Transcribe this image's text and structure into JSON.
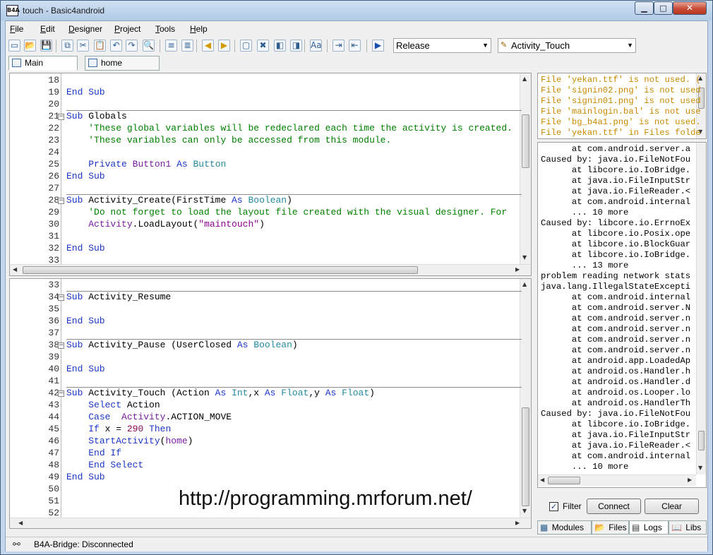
{
  "window": {
    "app_icon": "B4A",
    "title": "touch - Basic4android"
  },
  "window_buttons": {
    "minimize": "▁",
    "maximize": "□",
    "close": "✕"
  },
  "menu": [
    {
      "label": "File",
      "key": "F",
      "rest": "ile"
    },
    {
      "label": "Edit",
      "key": "E",
      "rest": "dit"
    },
    {
      "label": "Designer",
      "key": "D",
      "rest": "esigner"
    },
    {
      "label": "Project",
      "key": "P",
      "rest": "roject"
    },
    {
      "label": "Tools",
      "key": "T",
      "rest": "ools"
    },
    {
      "label": "Help",
      "key": "H",
      "rest": "elp"
    }
  ],
  "toolbar": {
    "icons": [
      "new-file-icon",
      "open-folder-icon",
      "save-icon",
      "copy-icon",
      "cut-icon",
      "paste-icon",
      "undo-icon",
      "redo-icon",
      "find-icon",
      "indent-icon",
      "outdent-icon",
      "back-arrow-icon",
      "forward-arrow-icon",
      "comment-icon",
      "uncomment-icon",
      "bookmark-prev-icon",
      "bookmark-next-icon",
      "font-size-icon",
      "block-indent-icon",
      "block-outdent-icon",
      "run-icon"
    ],
    "glyphs": [
      "▭",
      "📂",
      "💾",
      "⧉",
      "✂",
      "📋",
      "↶",
      "↷",
      "🔍",
      "≡",
      "≣",
      "◀",
      "▶",
      "▢",
      "✖",
      "◧",
      "◨",
      "Aa",
      "⇥",
      "⇤",
      "▶"
    ],
    "build_mode": "Release",
    "module_selector": "Activity_Touch"
  },
  "tabs": [
    {
      "label": "Main",
      "active": true
    },
    {
      "label": "home",
      "active": false
    }
  ],
  "editor_top": {
    "lines": [
      {
        "n": "18",
        "html": ""
      },
      {
        "n": "19",
        "html": "<span class='k'>End Sub</span>"
      },
      {
        "n": "20",
        "html": ""
      },
      {
        "n": "21",
        "html": "<span class='k'>Sub</span> Globals",
        "fold": true
      },
      {
        "n": "22",
        "html": "    <span class='c'>'These global variables will be redeclared each time the activity is created.</span>"
      },
      {
        "n": "23",
        "html": "    <span class='c'>'These variables can only be accessed from this module.</span>"
      },
      {
        "n": "24",
        "html": ""
      },
      {
        "n": "25",
        "html": "    <span class='k'>Private</span> <span class='a'>Button1</span> <span class='k'>As</span> <span class='t'>Button</span>"
      },
      {
        "n": "26",
        "html": "<span class='k'>End Sub</span>"
      },
      {
        "n": "27",
        "html": ""
      },
      {
        "n": "28",
        "html": "<span class='k'>Sub</span> Activity_Create(FirstTime <span class='k'>As</span> <span class='t'>Boolean</span>)",
        "fold": true
      },
      {
        "n": "29",
        "html": "    <span class='c'>'Do not forget to load the layout file created with the visual designer. For</span>"
      },
      {
        "n": "30",
        "html": "    <span class='a'>Activity</span>.LoadLayout(<span class='s'>\"maintouch\"</span>)"
      },
      {
        "n": "31",
        "html": ""
      },
      {
        "n": "32",
        "html": "<span class='k'>End Sub</span>"
      },
      {
        "n": "33",
        "html": ""
      }
    ]
  },
  "editor_bottom": {
    "lines": [
      {
        "n": "33",
        "html": ""
      },
      {
        "n": "34",
        "html": "<span class='k'>Sub</span> Activity_Resume",
        "fold": true
      },
      {
        "n": "35",
        "html": ""
      },
      {
        "n": "36",
        "html": "<span class='k'>End Sub</span>"
      },
      {
        "n": "37",
        "html": ""
      },
      {
        "n": "38",
        "html": "<span class='k'>Sub</span> Activity_Pause (UserClosed <span class='k'>As</span> <span class='t'>Boolean</span>)",
        "fold": true
      },
      {
        "n": "39",
        "html": ""
      },
      {
        "n": "40",
        "html": "<span class='k'>End Sub</span>"
      },
      {
        "n": "41",
        "html": ""
      },
      {
        "n": "42",
        "html": "<span class='k'>Sub</span> Activity_Touch (Action <span class='k'>As</span> <span class='t'>Int</span>,x <span class='k'>As</span> <span class='t'>Float</span>,y <span class='k'>As</span> <span class='t'>Float</span>)",
        "fold": true
      },
      {
        "n": "43",
        "html": "    <span class='k'>Select</span> Action"
      },
      {
        "n": "44",
        "html": "    <span class='k'>Case</span>  <span class='a'>Activity</span>.ACTION_MOVE"
      },
      {
        "n": "45",
        "html": "    <span class='k'>If</span> x = <span class='n'>290</span> <span class='k'>Then</span>"
      },
      {
        "n": "46",
        "html": "    <span class='k'>StartActivity</span>(<span class='a'>home</span>)"
      },
      {
        "n": "47",
        "html": "    <span class='k'>End If</span>"
      },
      {
        "n": "48",
        "html": "    <span class='k'>End Select</span>"
      },
      {
        "n": "49",
        "html": "<span class='k'>End Sub</span>"
      },
      {
        "n": "50",
        "html": ""
      },
      {
        "n": "51",
        "html": ""
      },
      {
        "n": "52",
        "html": ""
      }
    ]
  },
  "watermark": "http://programming.mrforum.net/",
  "log_warnings": [
    "File 'yekan.ttf' is not used. (",
    "File 'signin02.png' is not used",
    "File 'signin01.png' is not used",
    "File 'mainlogin.bal' is not use",
    "File 'bg_b4a1.png' is not used.",
    "File 'yekan.ttf' in Files folde"
  ],
  "log_lines": [
    "      at com.android.server.a",
    "Caused by: java.io.FileNotFou",
    "      at libcore.io.IoBridge.",
    "      at java.io.FileInputStr",
    "      at java.io.FileReader.<",
    "      at com.android.internal",
    "      ... 10 more",
    "Caused by: libcore.io.ErrnoEx",
    "      at libcore.io.Posix.ope",
    "      at libcore.io.BlockGuar",
    "      at libcore.io.IoBridge.",
    "      ... 13 more",
    "problem reading network stats",
    "java.lang.IllegalStateExcepti",
    "      at com.android.internal",
    "      at com.android.server.N",
    "      at com.android.server.n",
    "      at com.android.server.n",
    "      at com.android.server.n",
    "      at com.android.server.n",
    "      at android.app.LoadedAp",
    "      at android.os.Handler.h",
    "      at android.os.Handler.d",
    "      at android.os.Looper.lo",
    "      at android.os.HandlerTh",
    "Caused by: java.io.FileNotFou",
    "      at libcore.io.IoBridge.",
    "      at java.io.FileInputStr",
    "      at java.io.FileReader.<",
    "      at com.android.internal",
    "      ... 10 more"
  ],
  "log_controls": {
    "filter_label": "Filter",
    "filter_checked": true,
    "connect_label": "Connect",
    "clear_label": "Clear"
  },
  "panel_tabs": [
    {
      "label": "Modules",
      "icon": "modules-icon",
      "glyph": "▦"
    },
    {
      "label": "Files",
      "icon": "folder-icon",
      "glyph": "📂"
    },
    {
      "label": "Logs",
      "icon": "logs-icon",
      "glyph": "▤",
      "active": true
    },
    {
      "label": "Libs",
      "icon": "book-icon",
      "glyph": "📖"
    }
  ],
  "statusbar": {
    "bridge_icon": "⚯",
    "bridge_status": "B4A-Bridge: Disconnected"
  },
  "colors": {
    "keyword": "#1c35c8",
    "type": "#24899c",
    "comment": "#008000",
    "string": "#8b008b",
    "warning": "#c88a00"
  }
}
